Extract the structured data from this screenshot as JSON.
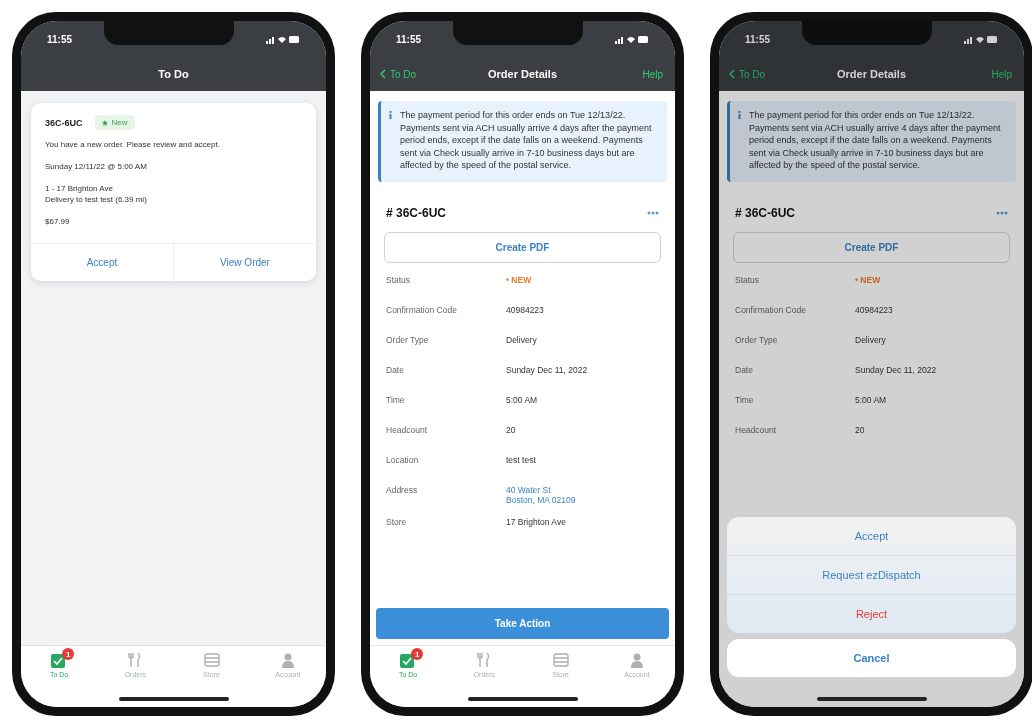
{
  "screens": [
    {
      "kind": "todo",
      "status_time": "11:55",
      "nav": {
        "title": "To Do"
      },
      "order_card": {
        "order_id": "36C-6UC",
        "badge": "New",
        "message": "You have a new order. Please review and accept.",
        "schedule": "Sunday 12/11/22 @ 5:00 AM",
        "store_line": "1 - 17 Brighton Ave",
        "delivery_line": "Delivery to test test (6.39 mi)",
        "total": "$67.99",
        "actions": [
          "Accept",
          "View Order"
        ]
      },
      "tab_bar": [
        {
          "kind": "todo",
          "label": "To Do",
          "selected": true,
          "badge": "1"
        },
        {
          "kind": "orders",
          "label": "Orders",
          "selected": false
        },
        {
          "kind": "store",
          "label": "Store",
          "selected": false
        },
        {
          "kind": "account",
          "label": "Account",
          "selected": false
        }
      ]
    },
    {
      "kind": "details",
      "status_time": "11:55",
      "nav": {
        "back": "To Do",
        "title": "Order Details",
        "action": "Help"
      },
      "notice": [
        "The payment period for this order ends on Tue 12/13/22.",
        "Payments sent via ACH usually arrive 4 days after the payment period ends, except if the date falls on a weekend. Payments sent via Check usually arrive in 7-10 business days but are affected by the speed of the postal service."
      ],
      "order_number": "# 36C-6UC",
      "create_pdf": "Create PDF",
      "details": [
        {
          "kind": "status",
          "label": "Status",
          "value": "• NEW"
        },
        {
          "kind": "text",
          "label": "Confirmation Code",
          "value": "40984223"
        },
        {
          "kind": "text",
          "label": "Order Type",
          "value": "Delivery"
        },
        {
          "kind": "text",
          "label": "Date",
          "value": "Sunday Dec 11, 2022"
        },
        {
          "kind": "text",
          "label": "Time",
          "value": "5:00 AM"
        },
        {
          "kind": "text",
          "label": "Headcount",
          "value": "20"
        },
        {
          "kind": "text",
          "label": "Location",
          "value": "test test"
        },
        {
          "kind": "link",
          "label": "Address",
          "value": "40 Water St\nBoston, MA 02109"
        },
        {
          "kind": "text",
          "label": "Store",
          "value": "17 Brighton Ave"
        }
      ],
      "primary_action": "Take Action",
      "tab_bar": [
        {
          "kind": "todo",
          "label": "To Do",
          "selected": true,
          "badge": "1"
        },
        {
          "kind": "orders",
          "label": "Orders",
          "selected": false
        },
        {
          "kind": "store",
          "label": "Store",
          "selected": false
        },
        {
          "kind": "account",
          "label": "Account",
          "selected": false
        }
      ]
    },
    {
      "kind": "details",
      "status_time": "11:55",
      "nav": {
        "back": "To Do",
        "title": "Order Details",
        "action": "Help"
      },
      "notice": [
        "The payment period for this order ends on Tue 12/13/22.",
        "Payments sent via ACH usually arrive 4 days after the payment period ends, except if the date falls on a weekend. Payments sent via Check usually arrive in 7-10 business days but are affected by the speed of the postal service."
      ],
      "order_number": "# 36C-6UC",
      "create_pdf": "Create PDF",
      "details": [
        {
          "kind": "status",
          "label": "Status",
          "value": "• NEW"
        },
        {
          "kind": "text",
          "label": "Confirmation Code",
          "value": "40984223"
        },
        {
          "kind": "text",
          "label": "Order Type",
          "value": "Delivery"
        },
        {
          "kind": "text",
          "label": "Date",
          "value": "Sunday Dec 11, 2022"
        },
        {
          "kind": "text",
          "label": "Time",
          "value": "5:00 AM"
        },
        {
          "kind": "text",
          "label": "Headcount",
          "value": "20"
        }
      ],
      "action_sheet": {
        "options": [
          {
            "kind": "default",
            "label": "Accept"
          },
          {
            "kind": "default",
            "label": "Request ezDispatch"
          },
          {
            "kind": "destructive",
            "label": "Reject"
          }
        ],
        "cancel": "Cancel"
      }
    }
  ]
}
